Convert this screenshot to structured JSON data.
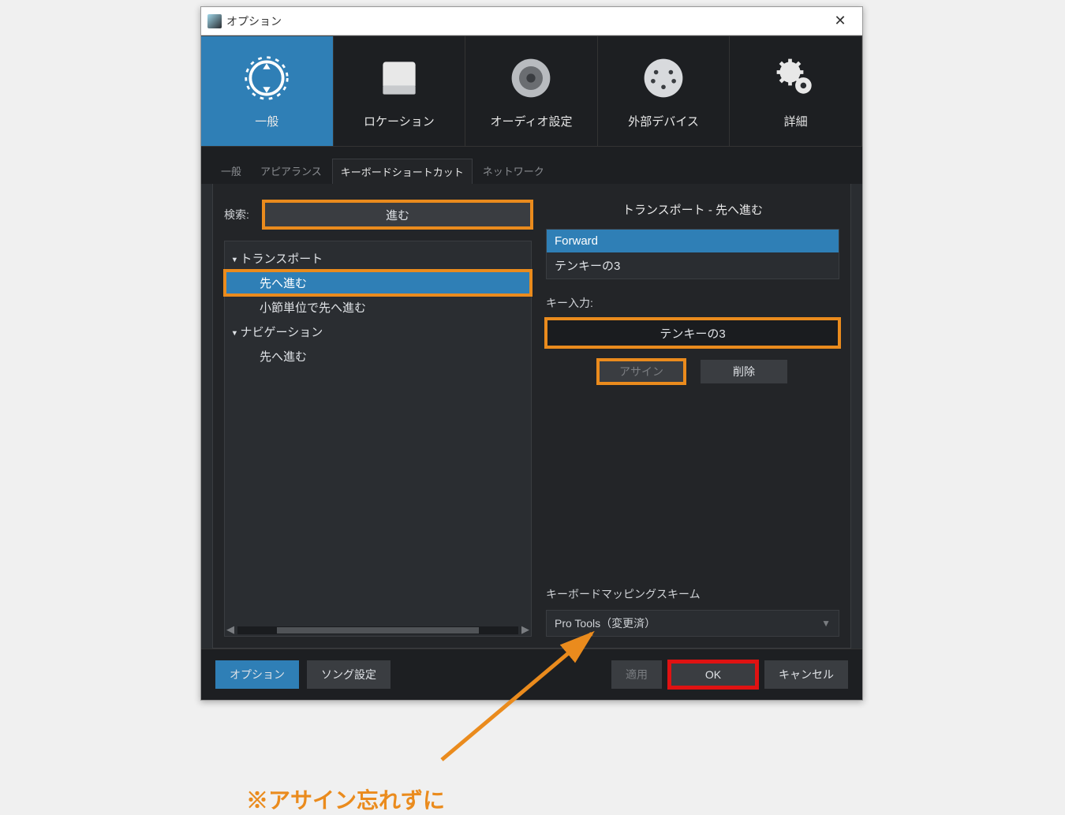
{
  "window": {
    "title": "オプション"
  },
  "nav": {
    "items": [
      {
        "label": "一般",
        "icon": "gear-sync-icon"
      },
      {
        "label": "ロケーション",
        "icon": "drive-icon"
      },
      {
        "label": "オーディオ設定",
        "icon": "speaker-icon"
      },
      {
        "label": "外部デバイス",
        "icon": "midi-device-icon"
      },
      {
        "label": "詳細",
        "icon": "gears-icon"
      }
    ],
    "active_index": 0
  },
  "sub_tabs": {
    "items": [
      "一般",
      "アピアランス",
      "キーボードショートカット",
      "ネットワーク"
    ],
    "active_index": 2
  },
  "search": {
    "label": "検索:",
    "value": "進む"
  },
  "tree": {
    "categories": [
      {
        "name": "トランスポート",
        "items": [
          "先へ進む",
          "小節単位で先へ進む"
        ],
        "selected_item": 0
      },
      {
        "name": "ナビゲーション",
        "items": [
          "先へ進む"
        ],
        "selected_item": null
      }
    ]
  },
  "right": {
    "title": "トランスポート - 先へ進む",
    "assignments": [
      "Forward",
      "テンキーの3"
    ],
    "selected_index": 0,
    "key_input_label": "キー入力:",
    "key_input_value": "テンキーの3",
    "assign_btn": "アサイン",
    "delete_btn": "削除",
    "scheme_label": "キーボードマッピングスキーム",
    "scheme_value": "Pro Tools（変更済）"
  },
  "footer": {
    "option_btn": "オプション",
    "song_btn": "ソング設定",
    "apply_btn": "適用",
    "ok_btn": "OK",
    "cancel_btn": "キャンセル"
  },
  "annotation": {
    "text": "※アサイン忘れずに"
  }
}
